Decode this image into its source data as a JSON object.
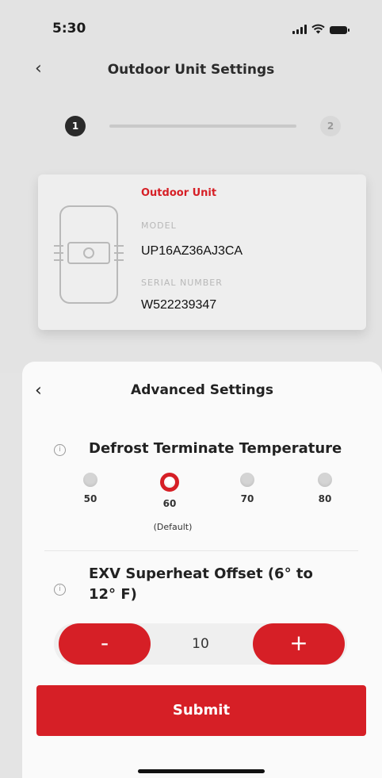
{
  "status_bar": {
    "time": "5:30"
  },
  "header": {
    "back_icon": "chevron-left-icon",
    "title": "Outdoor Unit Settings"
  },
  "stepper": {
    "steps": [
      "1",
      "2"
    ],
    "current": 1
  },
  "unit_card": {
    "label": "Outdoor Unit",
    "model_label": "MODEL",
    "model": "UP16AZ36AJ3CA",
    "serial_label": "SERIAL NUMBER",
    "serial": "W522239347"
  },
  "sheet": {
    "back_icon": "chevron-left-icon",
    "title": "Advanced Settings",
    "defrost": {
      "title": "Defrost Terminate Temperature",
      "options": [
        "50",
        "60",
        "70",
        "80"
      ],
      "selected": "60",
      "default_note": "(Default)"
    },
    "exv": {
      "title_line1": "EXV Superheat Offset (6° to",
      "title_line2": "12° F)",
      "minus_label": "-",
      "plus_label": "+",
      "value": "10"
    },
    "submit_label": "Submit"
  },
  "colors": {
    "accent": "#d61f26",
    "text": "#222222"
  }
}
